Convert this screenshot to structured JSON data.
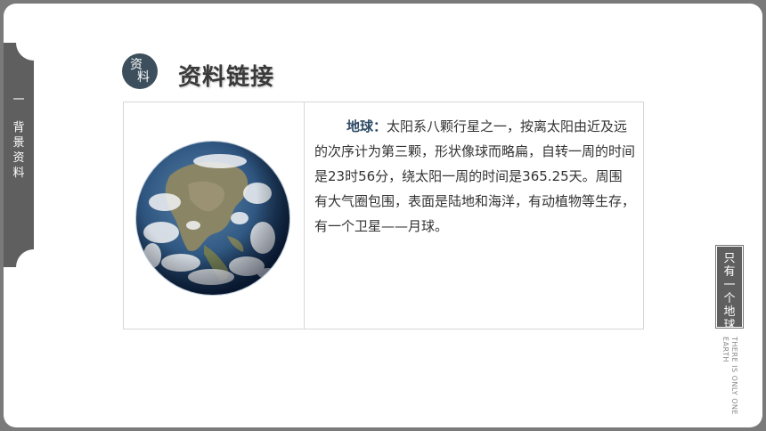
{
  "left_tab": {
    "chars": [
      "一",
      "背",
      "景",
      "资",
      "料"
    ]
  },
  "header": {
    "badge_chars": [
      "资",
      "料"
    ],
    "title": "资料链接"
  },
  "content": {
    "term": "地球",
    "colon": "：",
    "body": "太阳系八颗行星之一，按离太阳由近及远的次序计为第三颗，形状像球而略扁，自转一周的时间是23时56分，绕太阳一周的时间是365.25天。周围有大气圈包围，表面是陆地和海洋，有动植物等生存，有一个卫星——月球。"
  },
  "right_tab": {
    "chars": [
      "只",
      "有",
      "一",
      "个",
      "地",
      "球"
    ],
    "subtitle": "THERE IS ONLY ONE EARTH"
  },
  "colors": {
    "tab_gray": "#5f5f5f",
    "badge_blue": "#3d4f5c",
    "term_blue": "#2f4c66",
    "frame_gray": "#7a7a7a"
  }
}
